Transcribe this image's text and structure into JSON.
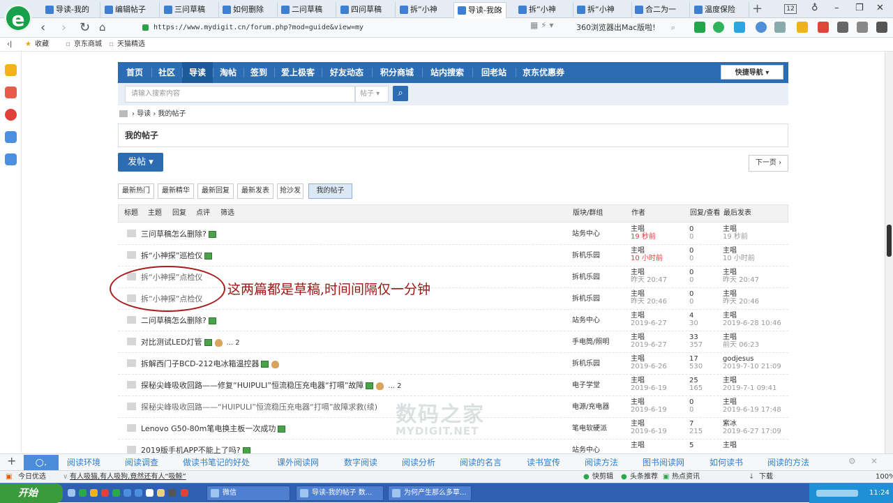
{
  "browser": {
    "tabs": [
      "导读-我的",
      "编辑帖子",
      "三问草稿",
      "如何删除",
      "二问草稿",
      "四问草稿",
      "拆“小神",
      "导读-我的",
      "拆“小神",
      "拆“小神",
      "合二为一",
      "温度保险"
    ],
    "active_tab_index": 7,
    "tab_count": "12",
    "url": "https://www.mydigit.cn/forum.php?mod=guide&view=my",
    "search_text": "360浏览器出Mac版啦!",
    "bookmarks": [
      "收藏",
      "京东商城",
      "天猫精选"
    ]
  },
  "forum": {
    "nav": [
      "首页",
      "社区",
      "导读",
      "淘帖",
      "签到",
      "爱上极客",
      "好友动态",
      "积分商城",
      "站内搜索",
      "回老站",
      "京东优惠券"
    ],
    "nav_active_index": 2,
    "quick_nav": "快捷导航",
    "search_placeholder": "请输入搜索内容",
    "search_type": "帖子",
    "breadcrumb": [
      "导读",
      "我的帖子"
    ],
    "page_title": "我的帖子",
    "post_button": "发帖",
    "next_page": "下一页",
    "filters": [
      "最新热门",
      "最新精华",
      "最新回复",
      "最新发表",
      "抢沙发",
      "我的帖子"
    ],
    "filter_active_index": 5,
    "table_head": {
      "left": [
        "标题",
        "主题",
        "回复",
        "点评",
        "筛选"
      ],
      "forum": "版块/群组",
      "author": "作者",
      "replies": "回复/查看",
      "last": "最后发表"
    },
    "rows": [
      {
        "title": "三问草稿怎么删除?",
        "pages": "",
        "draft": false,
        "attach": true,
        "hand": false,
        "forum": "站务中心",
        "author": "主唱",
        "date": "19 秒前",
        "date_new": true,
        "replies": "0",
        "views": "0",
        "last_user": "主唱",
        "last_time": "19 秒前"
      },
      {
        "title": "拆“小神探”巡检仪",
        "pages": "",
        "draft": false,
        "attach": true,
        "hand": false,
        "forum": "拆机乐园",
        "author": "主唱",
        "date": "10 小时前",
        "date_new": true,
        "replies": "0",
        "views": "0",
        "last_user": "主唱",
        "last_time": "10 小时前"
      },
      {
        "title": "拆“小神探”点检仪",
        "pages": "",
        "draft": true,
        "attach": false,
        "hand": false,
        "forum": "拆机乐园",
        "author": "主唱",
        "date": "昨天 20:47",
        "date_new": false,
        "replies": "0",
        "views": "0",
        "last_user": "主唱",
        "last_time": "昨天 20:47"
      },
      {
        "title": "拆“小神探”点检仪",
        "pages": "",
        "draft": true,
        "attach": false,
        "hand": false,
        "forum": "拆机乐园",
        "author": "主唱",
        "date": "昨天 20:46",
        "date_new": false,
        "replies": "0",
        "views": "0",
        "last_user": "主唱",
        "last_time": "昨天 20:46"
      },
      {
        "title": "二问草稿怎么删除?",
        "pages": "",
        "draft": false,
        "attach": true,
        "hand": false,
        "forum": "站务中心",
        "author": "主唱",
        "date": "2019-6-27",
        "date_new": false,
        "replies": "4",
        "views": "30",
        "last_user": "主唱",
        "last_time": "2019-6-28 10:46"
      },
      {
        "title": "对比测试LED灯管",
        "pages": "... 2",
        "draft": false,
        "attach": true,
        "hand": true,
        "forum": "手电筒/照明",
        "author": "主唱",
        "date": "2019-6-27",
        "date_new": false,
        "replies": "33",
        "views": "357",
        "last_user": "主唱",
        "last_time": "前天 06:23"
      },
      {
        "title": "拆解西门子BCD-212电冰箱温控器",
        "pages": "",
        "draft": false,
        "attach": true,
        "hand": true,
        "forum": "拆机乐园",
        "author": "主唱",
        "date": "2019-6-26",
        "date_new": false,
        "replies": "17",
        "views": "530",
        "last_user": "godjesus",
        "last_time": "2019-7-10 21:09"
      },
      {
        "title": "探秘尖峰吸收回路——修复“HUIPULI”恒流稳压充电器“打嗝”故障",
        "pages": "... 2",
        "draft": false,
        "attach": true,
        "hand": true,
        "forum": "电子学堂",
        "author": "主唱",
        "date": "2019-6-19",
        "date_new": false,
        "replies": "25",
        "views": "165",
        "last_user": "主唱",
        "last_time": "2019-7-1 09:41"
      },
      {
        "title": "探秘尖峰吸收回路——“HUIPULI”恒流稳压充电器“打嗝”故障求救(续)",
        "pages": "",
        "draft": true,
        "attach": false,
        "hand": false,
        "forum": "电源/充电器",
        "author": "主唱",
        "date": "2019-6-19",
        "date_new": false,
        "replies": "0",
        "views": "0",
        "last_user": "主唱",
        "last_time": "2019-6-19 17:48"
      },
      {
        "title": "Lenovo G50-80m笔电换主板一次成功",
        "pages": "",
        "draft": false,
        "attach": true,
        "hand": false,
        "forum": "笔电软硬派",
        "author": "主唱",
        "date": "2019-6-19",
        "date_new": false,
        "replies": "7",
        "views": "215",
        "last_user": "紫冰",
        "last_time": "2019-6-27 17:09"
      },
      {
        "title": "2019版手机APP不能上了吗?",
        "pages": "",
        "draft": false,
        "attach": true,
        "hand": false,
        "forum": "站务中心",
        "author": "主唱",
        "date": "",
        "date_new": false,
        "replies": "5",
        "views": "",
        "last_user": "主唱",
        "last_time": ""
      }
    ],
    "annotation": "这两篇都是草稿,时间间隔仅一分钟",
    "watermark_cn": "数码之家",
    "watermark_en": "MYDIGIT.NET"
  },
  "recommend_bar": [
    "阅读环境",
    "阅读调查",
    "做读书笔记的好处",
    "课外阅读网",
    "数字阅读",
    "阅读分析",
    "阅读的名言",
    "读书宣传",
    "阅读方法",
    "图书阅读网",
    "如何读书",
    "阅读的方法"
  ],
  "status_bar": {
    "left": "今日优选",
    "headline": "有人吸猫,有人吸狗,竟然还有人“吸鲸”",
    "right": [
      "快剪辑",
      "头条推荐",
      "热点资讯",
      "下载"
    ],
    "zoom": "100%"
  },
  "taskbar": {
    "start": "开始",
    "tasks": [
      "微信",
      "导读-我的帖子 数...",
      "为何产生那么多草..."
    ],
    "clock": "11:24"
  }
}
